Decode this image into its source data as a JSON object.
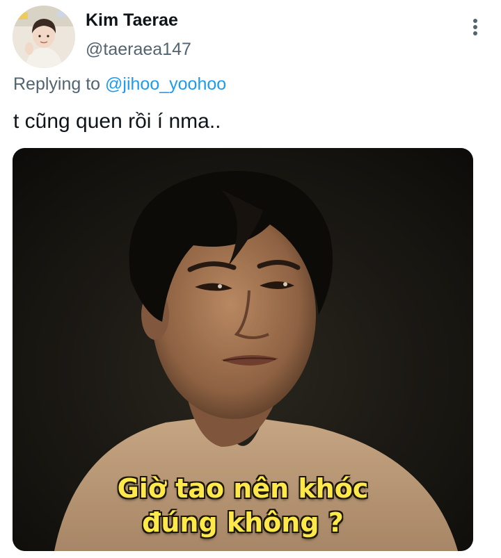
{
  "author": {
    "display_name": "Kim Taerae",
    "handle": "@taeraea147",
    "avatar_icon": "profile-photo"
  },
  "menu": {
    "icon": "more-vertical-icon"
  },
  "reply": {
    "prefix": "Replying to",
    "mention": "@jihoo_yoohoo"
  },
  "tweet": {
    "text": "t cũng quen rồi í nma.."
  },
  "media": {
    "caption_line1": "Giờ tao nên khóc",
    "caption_line2": "đúng không ?"
  },
  "colors": {
    "text_primary": "#0f1419",
    "text_secondary": "#536471",
    "link": "#1d9bf0",
    "caption": "#ffe94a"
  }
}
